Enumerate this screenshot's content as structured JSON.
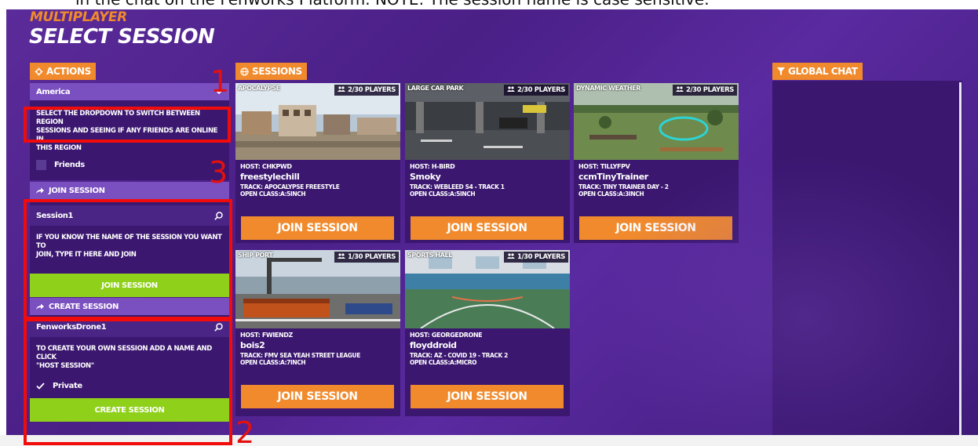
{
  "top_note": "in the chat on the Fenworks Platform.  NOTE: The session name is case sensitive.",
  "header": {
    "subtitle": "MULTIPLAYER",
    "title": "SELECT SESSION"
  },
  "sections": {
    "actions": "ACTIONS",
    "sessions": "SESSIONS",
    "global_chat": "GLOBAL CHAT"
  },
  "region": {
    "selected": "America",
    "hint_line1": "SELECT THE DROPDOWN TO SWITCH BETWEEN REGION",
    "hint_line2": "SESSIONS AND SEEING IF ANY FRIENDS ARE ONLINE IN",
    "hint_line3": "THIS REGION",
    "friends_label": "Friends",
    "friends_checked": false
  },
  "join": {
    "header": "JOIN SESSION",
    "input_value": "Session1",
    "hint_line1": "IF YOU KNOW THE NAME OF THE SESSION YOU WANT TO",
    "hint_line2": "JOIN, TYPE IT HERE AND JOIN",
    "button": "JOIN SESSION"
  },
  "create": {
    "header": "CREATE SESSION",
    "input_value": "FenworksDrone1",
    "hint_line1": "TO CREATE YOUR OWN SESSION ADD A NAME AND CLICK",
    "hint_line2": "\"HOST SESSION\"",
    "private_label": "Private",
    "private_checked": true,
    "button": "CREATE SESSION"
  },
  "session_cards": [
    {
      "scene": "APOCALYPSE",
      "players": "2/30 PLAYERS",
      "host": "HOST: CHKPWD",
      "name": "freestylechill",
      "track": "TRACK: APOCALYPSE FREESTYLE",
      "open_class": "OPEN CLASS:A:5INCH",
      "button": "JOIN SESSION"
    },
    {
      "scene": "LARGE CAR PARK",
      "players": "2/30 PLAYERS",
      "host": "HOST: H-BIRD",
      "name": "Smoky",
      "track": "TRACK: WEBLEED S4 - TRACK 1",
      "open_class": "OPEN CLASS:A:5INCH",
      "button": "JOIN SESSION"
    },
    {
      "scene": "DYNAMIC WEATHER",
      "players": "2/30 PLAYERS",
      "host": "HOST: TILLYFPV",
      "name": "ccmTinyTrainer",
      "track": "TRACK: TINY TRAINER DAY - 2",
      "open_class": "OPEN CLASS:A:3INCH",
      "button": "JOIN SESSION"
    },
    {
      "scene": "SHIP PORT",
      "players": "1/30 PLAYERS",
      "host": "HOST: FWIENDZ",
      "name": "bois2",
      "track": "TRACK: FMV SEA YEAH STREET LEAGUE",
      "open_class": "OPEN CLASS:A:7INCH",
      "button": "JOIN SESSION"
    },
    {
      "scene": "SPORTS HALL",
      "players": "1/30 PLAYERS",
      "host": "HOST: GEORGEDRONE",
      "name": "floyddroid",
      "track": "TRACK: AZ - COVID 19 - TRACK 2",
      "open_class": "OPEN CLASS:A:MICRO",
      "button": "JOIN SESSION"
    }
  ],
  "annotations": [
    "1",
    "3",
    "2"
  ],
  "colors": {
    "accent_orange": "#f08a2c",
    "accent_green": "#8fd11a",
    "panel_purple": "#3b1770",
    "bar_purple": "#7a4fc0",
    "annotation_red": "#f20b0b"
  },
  "icons": {
    "actions": "gear-icon",
    "sessions": "globe-icon",
    "chat": "filter-icon",
    "search": "search-icon",
    "arrow": "share-arrow-icon",
    "players": "players-icon",
    "dropdown": "chevron-down-icon",
    "check": "check-icon"
  }
}
